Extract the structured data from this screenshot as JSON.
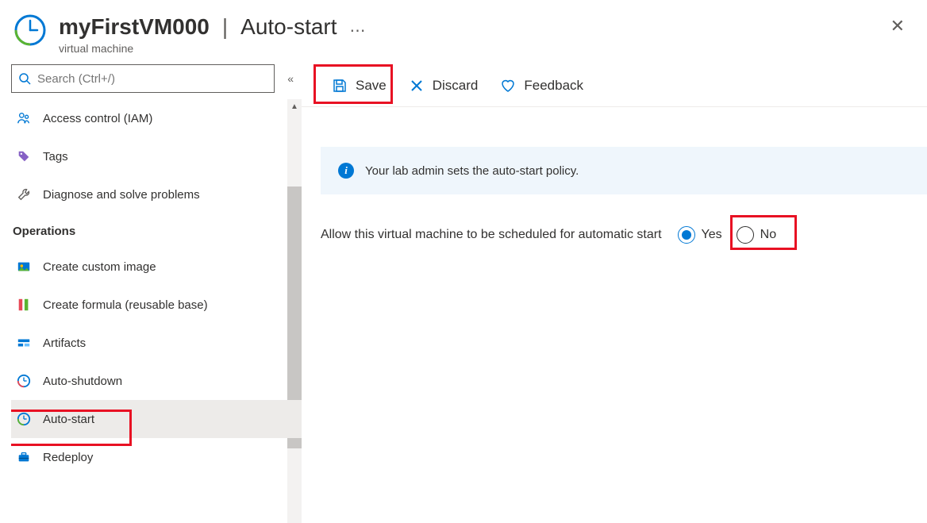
{
  "header": {
    "resource_name": "myFirstVM000",
    "blade_title": "Auto-start",
    "resource_type": "virtual machine"
  },
  "sidebar": {
    "search_placeholder": "Search (Ctrl+/)",
    "items_top": [
      {
        "label": "Access control (IAM)",
        "icon": "people-icon"
      },
      {
        "label": "Tags",
        "icon": "tag-icon"
      },
      {
        "label": "Diagnose and solve problems",
        "icon": "wrench-icon"
      }
    ],
    "section_title": "Operations",
    "items_ops": [
      {
        "label": "Create custom image",
        "icon": "image-icon"
      },
      {
        "label": "Create formula (reusable base)",
        "icon": "formula-icon"
      },
      {
        "label": "Artifacts",
        "icon": "artifacts-icon"
      },
      {
        "label": "Auto-shutdown",
        "icon": "clock-shutdown-icon"
      },
      {
        "label": "Auto-start",
        "icon": "clock-start-icon",
        "selected": true
      },
      {
        "label": "Redeploy",
        "icon": "briefcase-icon"
      }
    ]
  },
  "toolbar": {
    "save_label": "Save",
    "discard_label": "Discard",
    "feedback_label": "Feedback"
  },
  "info_banner": {
    "text": "Your lab admin sets the auto-start policy."
  },
  "setting": {
    "label": "Allow this virtual machine to be scheduled for automatic start",
    "yes_label": "Yes",
    "no_label": "No",
    "value": "yes"
  }
}
